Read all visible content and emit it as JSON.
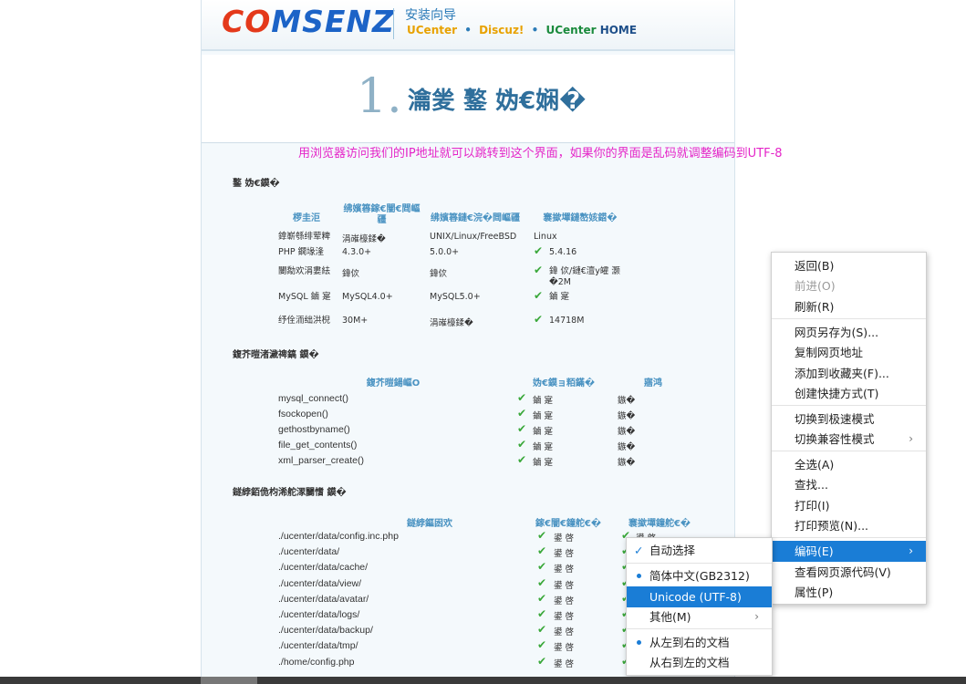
{
  "header": {
    "logo_a": "C",
    "logo_b": "O",
    "logo_c": "MSENZ",
    "wizard_title": "安装向导",
    "product_ucenter": "UCenter",
    "product_discuz": "Discuz!",
    "product_uchome_a": "UCenter",
    "product_uchome_b": "HOME",
    "separator": "•"
  },
  "step": {
    "number": "1.",
    "title": "瀹夎 鐜  妫€娴�"
  },
  "annotation": "用浏览器访问我们的IP地址就可以跳转到这个界面，如果你的界面是乱码就调整编码到UTF-8",
  "env_section": {
    "title": "鐜  妫€鏌�",
    "headers": [
      "椤圭洰",
      "绋嬪簭鎵€闇€閰嶇疆",
      "绋嬪簭鏈€浣�閰嶇疆",
      "褰撳墠鏈嶅姟鍣�"
    ],
    "rows": [
      {
        "item": "鎿嶄綔绯荤粺",
        "required": "涓嶉檺鍒�",
        "best": "UNIX/Linux/FreeBSD",
        "current": "Linux",
        "ok": false
      },
      {
        "item": "PHP 鐗堟湰",
        "required": "4.3.0+",
        "best": "5.0.0+",
        "current": "5.4.16",
        "ok": true
      },
      {
        "item": "闄勪欢涓婁紶",
        "required": "鍏佽",
        "best": "鍏佽",
        "current": "鍏 佽/鏈€澶у皬 灏�2M",
        "ok": true
      },
      {
        "item": "MySQL 鏀 寔",
        "required": "MySQL4.0+",
        "best": "MySQL5.0+",
        "current": "鏀 寔",
        "ok": true
      },
      {
        "item": "纾佺洏绌洪棿",
        "required": "30M+",
        "best": "涓嶉檺鍒�",
        "current": "14718M",
        "ok": true
      }
    ]
  },
  "func_section": {
    "title": "鍑芥暟渚濊禆鎬 鏌�",
    "headers": [
      "鍑芥暟鍚嶇О",
      "妫€鏌ョ粨鏋�",
      "寤鸿"
    ],
    "rows": [
      {
        "name": "mysql_connect()",
        "result": "鏀 寔",
        "advice": "鏃�"
      },
      {
        "name": "fsockopen()",
        "result": "鏀 寔",
        "advice": "鏃�"
      },
      {
        "name": "gethostbyname()",
        "result": "鏀 寔",
        "advice": "鏃�"
      },
      {
        "name": "file_get_contents()",
        "result": "鏀 寔",
        "advice": "鏃�"
      },
      {
        "name": "xml_parser_create()",
        "result": "鏀 寔",
        "advice": "鏃�"
      }
    ]
  },
  "dir_section": {
    "title": "鐩綍銆佹枃浠舵潈闄愭 鏌�",
    "headers": [
      "鐩綍鏂囦欢",
      "鎵€闇€鐘舵€�",
      "褰撳墠鐘舵€�"
    ],
    "rows": [
      {
        "path": "./ucenter/data/config.inc.php",
        "required": "鍙 啓",
        "current": "鍙 啓"
      },
      {
        "path": "./ucenter/data/",
        "required": "鍙 啓",
        "current": ""
      },
      {
        "path": "./ucenter/data/cache/",
        "required": "鍙 啓",
        "current": ""
      },
      {
        "path": "./ucenter/data/view/",
        "required": "鍙 啓",
        "current": ""
      },
      {
        "path": "./ucenter/data/avatar/",
        "required": "鍙 啓",
        "current": ""
      },
      {
        "path": "./ucenter/data/logs/",
        "required": "鍙 啓",
        "current": ""
      },
      {
        "path": "./ucenter/data/backup/",
        "required": "鍙 啓",
        "current": ""
      },
      {
        "path": "./ucenter/data/tmp/",
        "required": "鍙 啓",
        "current": ""
      },
      {
        "path": "./home/config.php",
        "required": "鍙 啓",
        "current": ""
      }
    ]
  },
  "context_menu": {
    "items": [
      {
        "label": "返回(B)",
        "disabled": false
      },
      {
        "label": "前进(O)",
        "disabled": true
      },
      {
        "label": "刷新(R)",
        "disabled": false
      },
      {
        "label": "网页另存为(S)...",
        "disabled": false
      },
      {
        "label": "复制网页地址",
        "disabled": false
      },
      {
        "label": "添加到收藏夹(F)...",
        "disabled": false
      },
      {
        "label": "创建快捷方式(T)",
        "disabled": false
      },
      {
        "label": "切换到极速模式",
        "disabled": false
      },
      {
        "label": "切换兼容性模式",
        "disabled": false
      },
      {
        "label": "全选(A)",
        "disabled": false
      },
      {
        "label": "查找...",
        "disabled": false
      },
      {
        "label": "打印(I)",
        "disabled": false
      },
      {
        "label": "打印预览(N)...",
        "disabled": false
      },
      {
        "label": "编码(E)",
        "disabled": false
      },
      {
        "label": "查看网页源代码(V)",
        "disabled": false
      },
      {
        "label": "属性(P)",
        "disabled": false
      }
    ]
  },
  "encoding_menu": {
    "items": [
      {
        "label": "自动选择"
      },
      {
        "label": "简体中文(GB2312)"
      },
      {
        "label": "Unicode (UTF-8)"
      },
      {
        "label": "其他(M)"
      },
      {
        "label": "从左到右的文档"
      },
      {
        "label": "从右到左的文档"
      }
    ]
  },
  "glyphs": {
    "check": "✔",
    "tick": "✓",
    "arrow": "›"
  },
  "colors": {
    "menu_highlight": "#1a7dd6",
    "annotation": "#e424c8",
    "check": "#3aa83a",
    "logo_blue": "#1c63c7",
    "logo_red": "#e4391b"
  }
}
